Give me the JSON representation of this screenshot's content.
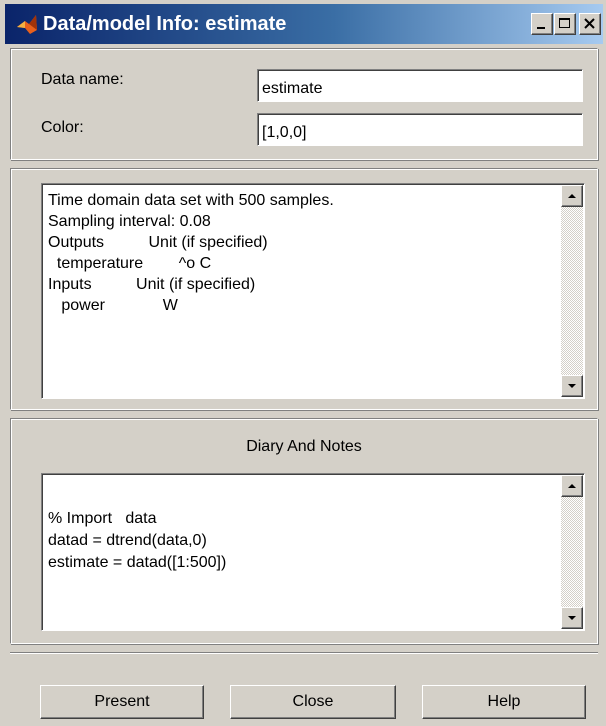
{
  "window": {
    "title": "Data/model Info: estimate",
    "controls": [
      "minimize",
      "maximize",
      "close"
    ]
  },
  "properties": {
    "data_name_label": "Data name:",
    "data_name_value": "estimate",
    "color_label": "Color:",
    "color_value": "[1,0,0]"
  },
  "info": {
    "lines": [
      "Time domain data set with 500 samples.",
      "Sampling interval: 0.08",
      "Outputs          Unit (if specified)",
      "  temperature        ^o C",
      "Inputs          Unit (if specified)",
      "   power             W"
    ]
  },
  "diary": {
    "title": "Diary And Notes",
    "lines": [
      "% Import   data",
      "datad = dtrend(data,0)",
      "estimate = datad([1:500])"
    ]
  },
  "buttons": {
    "present": "Present",
    "close": "Close",
    "help": "Help"
  }
}
